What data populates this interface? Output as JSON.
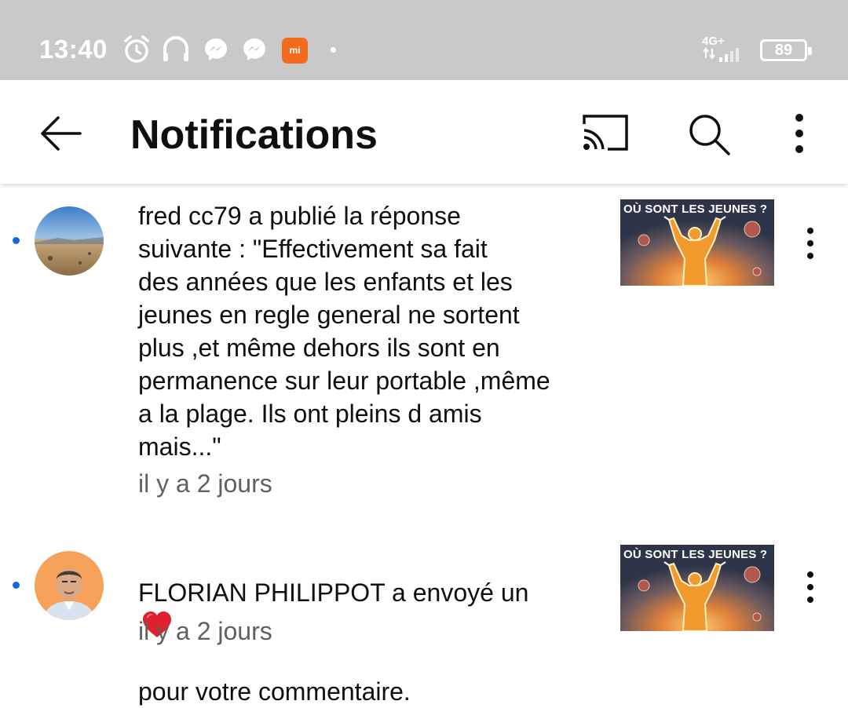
{
  "status_bar": {
    "time": "13:40",
    "network": "4G+",
    "battery": "89",
    "icons": [
      "alarm-icon",
      "headphones-icon",
      "messenger-icon",
      "messenger-icon",
      "mi-app-icon"
    ]
  },
  "app_bar": {
    "title": "Notifications",
    "icons": [
      "back-arrow-icon",
      "cast-icon",
      "search-icon",
      "more-vert-icon"
    ]
  },
  "notifications": [
    {
      "text": "fred cc79 a publié la réponse\nsuivante : \"Effectivement sa fait\ndes années que les enfants et les\njeunes en regle general ne sortent\nplus ,et même dehors ils sont en\npermanence sur leur portable ,même\na la plage. Ils ont pleins d amis\nmais...\"",
      "time": "il y a 2 jours",
      "thumbnail_title": "OÙ SONT LES JEUNES ?",
      "unread": true
    },
    {
      "text_before_heart": "FLORIAN PHILIPPOT a envoyé un",
      "text_after_heart": "pour votre commentaire.",
      "time": "il y a 2 jours",
      "thumbnail_title": "OÙ SONT LES JEUNES ?",
      "unread": true
    }
  ],
  "colors": {
    "status_bar": "#c9c9c9",
    "unread_dot": "#1a66d6",
    "heart": "#e0202e",
    "mi_badge": "#f26b1d"
  }
}
